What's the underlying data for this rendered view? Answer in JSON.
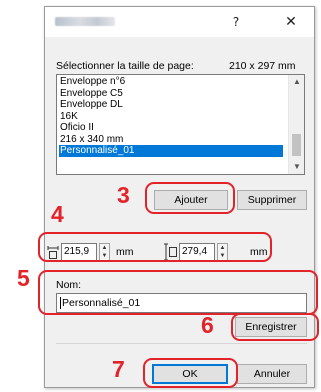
{
  "window": {
    "help_glyph": "?",
    "close_glyph": "✕"
  },
  "page_size": {
    "label": "Sélectionner la taille de page:",
    "value": "210 x 297 mm"
  },
  "list": {
    "items": [
      "Enveloppe n°6",
      "Enveloppe C5",
      "Enveloppe DL",
      "16K",
      "Oficio II",
      "216 x 340 mm",
      "Personnalisé_01"
    ],
    "selected_index": 6
  },
  "buttons": {
    "add": "Ajouter",
    "delete": "Supprimer",
    "save": "Enregistrer",
    "ok": "OK",
    "cancel": "Annuler"
  },
  "dimensions": {
    "width_value": "215,9",
    "width_unit": "mm",
    "height_value": "279,4",
    "height_unit": "mm"
  },
  "name_field": {
    "label": "Nom:",
    "value": "Personnalisé_01"
  },
  "steps": {
    "s3": "3",
    "s4": "4",
    "s5": "5",
    "s6": "6",
    "s7": "7"
  },
  "colors": {
    "highlight": "#e2232a",
    "selection": "#0078d7"
  }
}
